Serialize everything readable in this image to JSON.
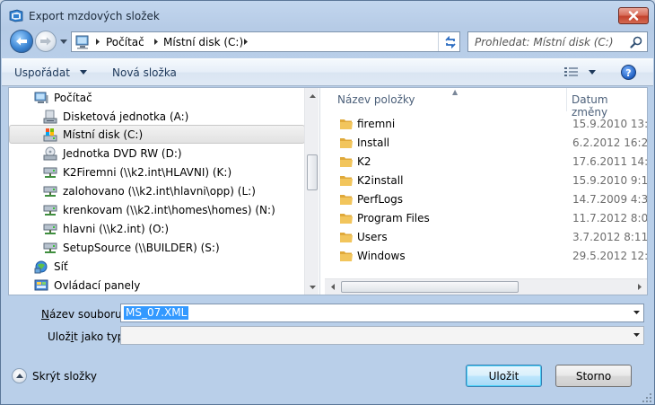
{
  "window": {
    "title": "Export mzdových složek"
  },
  "address": {
    "crumbs": [
      "Počítač",
      "Místní disk (C:)"
    ]
  },
  "search": {
    "placeholder": "Prohledat: Místní disk (C:)"
  },
  "toolbar": {
    "organize_label": "Uspořádat",
    "new_folder_label": "Nová složka"
  },
  "nav": {
    "items": [
      {
        "label": "Počítač",
        "icon": "computer-icon"
      },
      {
        "label": "Disketová jednotka (A:)",
        "icon": "floppy-drive-icon"
      },
      {
        "label": "Místní disk (C:)",
        "icon": "local-disk-icon",
        "selected": true
      },
      {
        "label": "Jednotka DVD RW (D:)",
        "icon": "dvd-drive-icon"
      },
      {
        "label": "K2Firemni (\\\\k2.int\\HLAVNI) (K:)",
        "icon": "network-drive-icon"
      },
      {
        "label": "zalohovano (\\\\k2.int\\hlavni\\opp) (L:)",
        "icon": "network-drive-icon"
      },
      {
        "label": "krenkovam (\\\\k2.int\\homes\\homes) (N:)",
        "icon": "network-drive-icon"
      },
      {
        "label": "hlavni (\\\\k2.int) (O:)",
        "icon": "network-drive-icon"
      },
      {
        "label": "SetupSource (\\\\BUILDER) (S:)",
        "icon": "network-drive-icon"
      },
      {
        "label": "Síť",
        "icon": "network-icon"
      },
      {
        "label": "Ovládací panely",
        "icon": "control-panel-icon"
      }
    ]
  },
  "files": {
    "columns": {
      "name": "Název položky",
      "date": "Datum změny"
    },
    "rows": [
      {
        "name": "firemni",
        "date": "15.9.2010 13:18"
      },
      {
        "name": "Install",
        "date": "6.2.2012 16:22"
      },
      {
        "name": "K2",
        "date": "17.6.2011 14:13"
      },
      {
        "name": "K2install",
        "date": "15.9.2010 9:14"
      },
      {
        "name": "PerfLogs",
        "date": "14.7.2009 4:37"
      },
      {
        "name": "Program Files",
        "date": "11.7.2012 8:06"
      },
      {
        "name": "Users",
        "date": "3.7.2012 8:11"
      },
      {
        "name": "Windows",
        "date": "29.5.2012 12:27"
      }
    ]
  },
  "form": {
    "filename_label_accel": "N",
    "filename_label_rest": "ázev souboru:",
    "filename_value": "MS_07.XML",
    "filetype_label_pre": "Ulož",
    "filetype_label_accel": "i",
    "filetype_label_post": "t jako typ:",
    "filetype_value": ""
  },
  "footer": {
    "hide_folders_label": "Skrýt složky",
    "save_label": "Uložit",
    "cancel_label": "Storno"
  },
  "colors": {
    "selection": "#3399ff",
    "close_button": "#c3412c",
    "folder": "#f2c55c"
  }
}
